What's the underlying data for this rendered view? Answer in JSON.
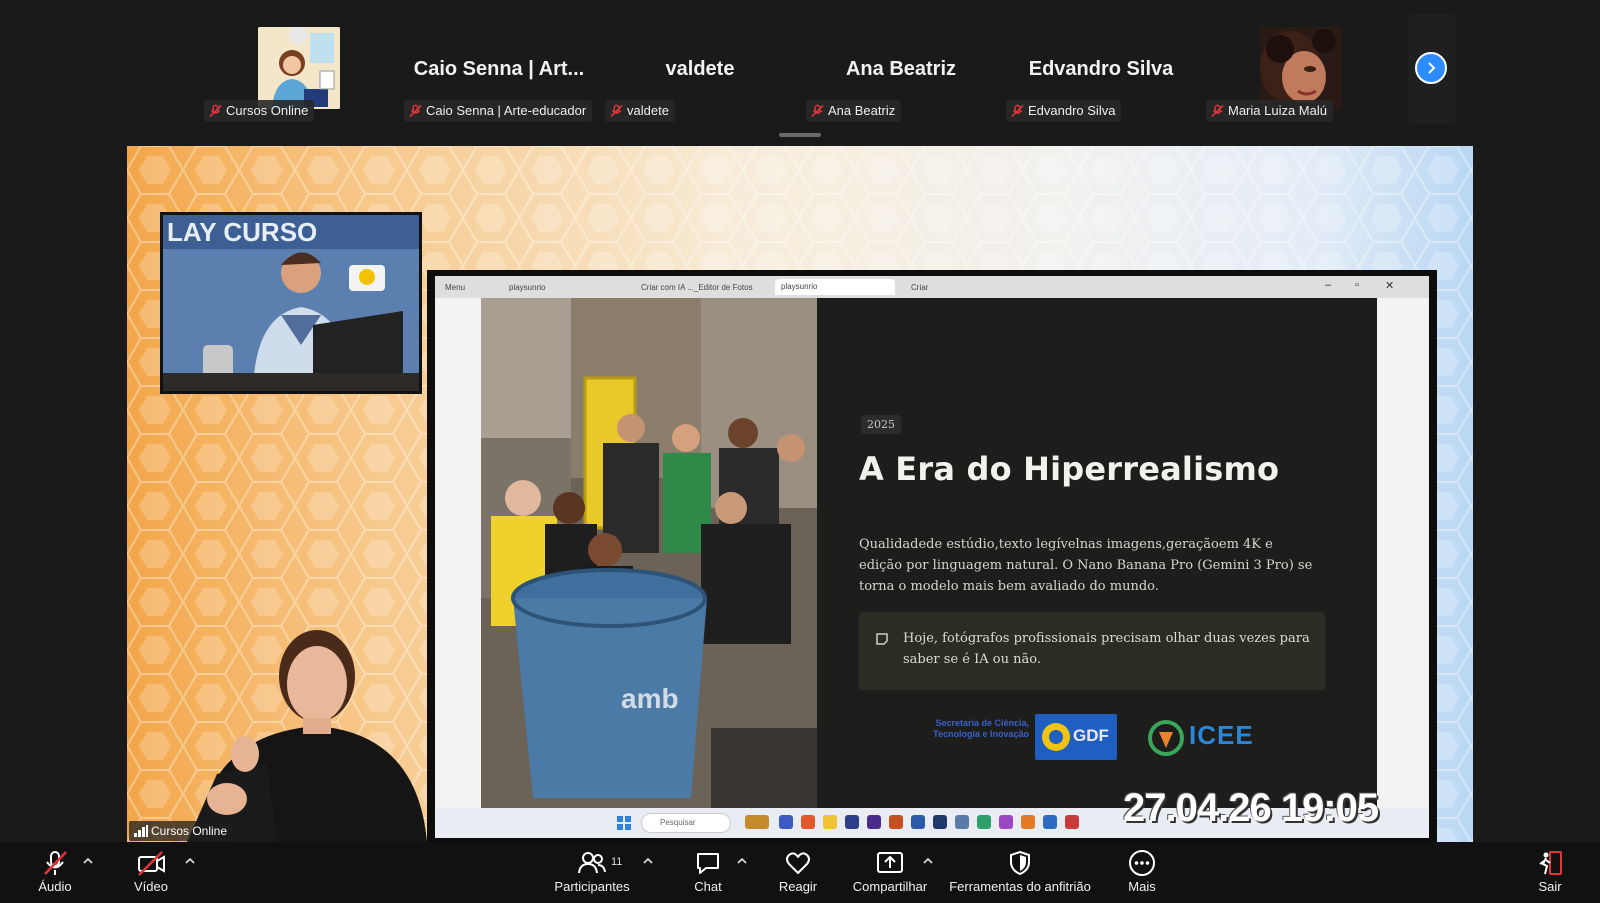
{
  "participants": [
    {
      "tile_name": "",
      "label": "Cursos Online",
      "type": "avatar-illustration"
    },
    {
      "tile_name": "Caio Senna | Art...",
      "label": "Caio Senna | Arte-educador",
      "type": "name"
    },
    {
      "tile_name": "valdete",
      "label": "valdete",
      "type": "name"
    },
    {
      "tile_name": "Ana Beatriz",
      "label": "Ana Beatriz",
      "type": "name"
    },
    {
      "tile_name": "Edvandro Silva",
      "label": "Edvandro Silva",
      "type": "name"
    },
    {
      "tile_name": "",
      "label": "Maria Luiza Malú",
      "type": "avatar-photo"
    }
  ],
  "strip": {
    "next_icon": "chevron-right-icon",
    "mic_icon": "mic-off-icon"
  },
  "share": {
    "speaker_banner": "LAY CURSO",
    "sharer_label": "Cursos Online",
    "timestamp": "27.04.26 19:05",
    "browser": {
      "tabs": [
        "Menu",
        "playsunrio",
        "Criar com IA ..._Editor de Fotos",
        "playsunrio",
        "Criar"
      ]
    },
    "slide": {
      "year": "2025",
      "title": "A Era do Hiperrealismo",
      "body": "Qualidadede estúdio,texto legívelnas imagens,geraçãoem 4K e edição por linguagem natural. O Nano Banana Pro (Gemini 3 Pro) se torna o modelo mais bem avaliado do mundo.",
      "note": "Hoje, fotógrafos profissionais precisam olhar duas vezes para saber se é IA ou não.",
      "logo_secretaria": "Secretaria de Ciência, Tecnologia e Inovação",
      "logo_gdf": "GDF",
      "logo_icee": "ICEE"
    },
    "taskbar": {
      "search_placeholder": "Pesquisar"
    }
  },
  "toolbar": {
    "audio": {
      "label": "Áudio",
      "icon": "mic-muted-icon"
    },
    "video": {
      "label": "Vídeo",
      "icon": "video-off-icon"
    },
    "participants": {
      "label": "Participantes",
      "count": "11",
      "icon": "people-icon"
    },
    "chat": {
      "label": "Chat",
      "icon": "chat-bubble-icon"
    },
    "react": {
      "label": "Reagir",
      "icon": "heart-icon"
    },
    "share": {
      "label": "Compartilhar",
      "icon": "share-screen-icon"
    },
    "host_tools": {
      "label": "Ferramentas do anfitrião",
      "icon": "shield-icon"
    },
    "more": {
      "label": "Mais",
      "icon": "more-dots-icon"
    },
    "leave": {
      "label": "Sair",
      "icon": "leave-icon"
    }
  },
  "colors": {
    "accent": "#2d8cff",
    "muted_red": "#e0333a",
    "bar_bg": "#111111"
  }
}
